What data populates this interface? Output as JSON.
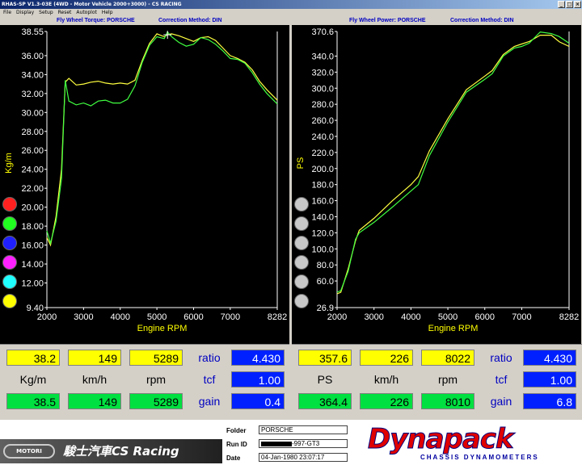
{
  "window": {
    "title": "RHAS-SP V1.3-03E  (4WD - Motor Vehicle 2000+3000) - CS RACING",
    "menu": [
      "File",
      "Display",
      "Setup",
      "Reset",
      "Autoplot",
      "Help"
    ]
  },
  "left_chart_header": {
    "title": "Fly Wheel Torque: PORSCHE",
    "method": "Correction Method: DIN"
  },
  "right_chart_header": {
    "title": "Fly Wheel Power: PORSCHE",
    "method": "Correction Method: DIN"
  },
  "legend_dot_colors": [
    "#ff2020",
    "#20ff20",
    "#2020ff",
    "#ff20ff",
    "#20ffff",
    "#ffff00"
  ],
  "right_dot_colors": [
    "#c8c8c8",
    "#c8c8c8",
    "#c8c8c8",
    "#c8c8c8",
    "#c8c8c8",
    "#c8c8c8"
  ],
  "chart_data": [
    {
      "type": "line",
      "title": "Fly Wheel Torque: PORSCHE",
      "xlabel": "Engine RPM",
      "ylabel": "Kg/m",
      "xlim": [
        2000,
        8282
      ],
      "ylim": [
        9.4,
        38.55
      ],
      "xticks": [
        "2000",
        "3000",
        "4000",
        "5000",
        "6000",
        "7000",
        "8282"
      ],
      "yticks": [
        "38.55",
        "36.00",
        "34.00",
        "32.00",
        "30.00",
        "28.00",
        "26.00",
        "24.00",
        "22.00",
        "20.00",
        "18.00",
        "16.00",
        "14.00",
        "12.00",
        "9.40"
      ],
      "series": [
        {
          "color": "#ffff40",
          "x": [
            2000,
            2100,
            2250,
            2400,
            2500,
            2600,
            2800,
            3000,
            3200,
            3400,
            3600,
            3800,
            4000,
            4200,
            4400,
            4600,
            4800,
            5000,
            5200,
            5289,
            5400,
            5600,
            5800,
            6000,
            6200,
            6400,
            6600,
            6800,
            7000,
            7200,
            7400,
            7600,
            7800,
            8000,
            8282
          ],
          "y": [
            16.8,
            16.0,
            19.0,
            24.0,
            33.2,
            33.6,
            32.9,
            33.0,
            33.2,
            33.3,
            33.1,
            33.0,
            33.1,
            33.0,
            33.4,
            35.5,
            37.3,
            38.3,
            38.0,
            38.2,
            38.3,
            38.1,
            37.8,
            37.5,
            37.9,
            38.0,
            37.6,
            36.8,
            36.0,
            35.7,
            35.3,
            34.5,
            33.3,
            32.4,
            31.3
          ]
        },
        {
          "color": "#40ff40",
          "x": [
            2000,
            2100,
            2250,
            2400,
            2500,
            2600,
            2800,
            3000,
            3200,
            3400,
            3600,
            3800,
            4000,
            4200,
            4400,
            4600,
            4800,
            5000,
            5200,
            5289,
            5400,
            5600,
            5800,
            6000,
            6200,
            6400,
            6600,
            6800,
            7000,
            7200,
            7400,
            7600,
            7800,
            8000,
            8282
          ],
          "y": [
            17.5,
            16.2,
            18.5,
            23.0,
            33.4,
            31.2,
            30.8,
            31.0,
            30.7,
            31.2,
            31.3,
            31.0,
            31.0,
            31.4,
            32.8,
            35.3,
            37.1,
            38.0,
            37.8,
            38.5,
            38.0,
            37.4,
            37.0,
            37.2,
            37.9,
            37.7,
            37.2,
            36.5,
            35.7,
            35.6,
            35.2,
            34.2,
            33.0,
            32.0,
            30.9
          ]
        }
      ]
    },
    {
      "type": "line",
      "title": "Fly Wheel Power: PORSCHE",
      "xlabel": "Engine RPM",
      "ylabel": "PS",
      "xlim": [
        2000,
        8282
      ],
      "ylim": [
        26.9,
        370.6
      ],
      "xticks": [
        "2000",
        "3000",
        "4000",
        "5000",
        "6000",
        "7000",
        "8282"
      ],
      "yticks": [
        "370.6",
        "340.0",
        "320.0",
        "300.0",
        "280.0",
        "260.0",
        "240.0",
        "220.0",
        "200.0",
        "180.0",
        "160.0",
        "140.0",
        "120.0",
        "100.0",
        "80.0",
        "60.0",
        "26.9"
      ],
      "series": [
        {
          "color": "#ffff40",
          "x": [
            2000,
            2100,
            2300,
            2500,
            2600,
            3000,
            3500,
            4000,
            4200,
            4500,
            5000,
            5500,
            6000,
            6200,
            6500,
            6800,
            7000,
            7200,
            7500,
            7800,
            8022,
            8282
          ],
          "y": [
            44,
            46,
            75,
            110,
            123,
            138,
            160,
            180,
            190,
            222,
            262,
            298,
            315,
            322,
            342,
            352,
            355,
            358,
            366,
            366,
            357.6,
            352
          ]
        },
        {
          "color": "#40ff40",
          "x": [
            2000,
            2100,
            2300,
            2500,
            2600,
            3000,
            3500,
            4000,
            4200,
            4500,
            5000,
            5500,
            6000,
            6200,
            6500,
            6800,
            7000,
            7200,
            7500,
            7800,
            8010,
            8282
          ],
          "y": [
            46,
            48,
            72,
            112,
            120,
            133,
            152,
            172,
            180,
            216,
            258,
            295,
            311,
            318,
            340,
            350,
            352,
            356,
            370,
            368,
            364.4,
            356
          ]
        }
      ]
    }
  ],
  "left_readout": {
    "top": [
      "38.2",
      "149",
      "5289"
    ],
    "units": [
      "Kg/m",
      "km/h",
      "rpm"
    ],
    "bottom": [
      "38.5",
      "149",
      "5289"
    ],
    "ratio_label": "ratio",
    "ratio": "4.430",
    "tcf_label": "tcf",
    "tcf": "1.00",
    "gain_label": "gain",
    "gain": "0.4"
  },
  "right_readout": {
    "top": [
      "357.6",
      "226",
      "8022"
    ],
    "units": [
      "PS",
      "km/h",
      "rpm"
    ],
    "bottom": [
      "364.4",
      "226",
      "8010"
    ],
    "ratio_label": "ratio",
    "ratio": "4.430",
    "tcf_label": "tcf",
    "tcf": "1.00",
    "gain_label": "gain",
    "gain": "6.8"
  },
  "footer": {
    "shop_name": "駿士汽車CS Racing",
    "emblem": "MOTORI",
    "folder_label": "Folder",
    "folder": "PORSCHE",
    "run_label": "Run ID",
    "run": "-997-GT3",
    "date_label": "Date",
    "date": "04-Jan-1980  23:07:17",
    "brand": "Dynapack",
    "brand_sub": "CHASSIS DYNAMOMETERS"
  }
}
